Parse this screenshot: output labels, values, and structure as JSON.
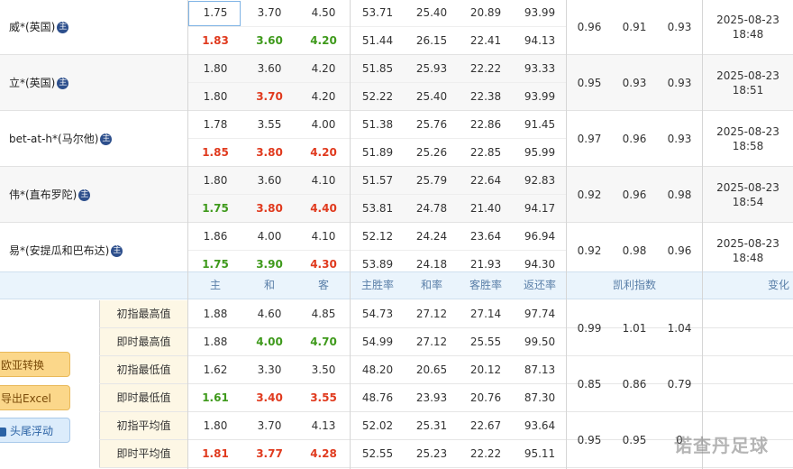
{
  "bookmakers": [
    {
      "name": "威*(英国)",
      "initial": [
        "1.75",
        "3.70",
        "4.50"
      ],
      "current": [
        "1.83",
        "3.60",
        "4.20"
      ],
      "current_colors": [
        "red",
        "green",
        "green"
      ],
      "initial_rates": [
        "53.71",
        "25.40",
        "20.89",
        "93.99"
      ],
      "current_rates": [
        "51.44",
        "26.15",
        "22.41",
        "94.13"
      ],
      "kelly": [
        "0.96",
        "0.91",
        "0.93"
      ],
      "date": "2025-08-23",
      "time": "18:48"
    },
    {
      "name": "立*(英国)",
      "initial": [
        "1.80",
        "3.60",
        "4.20"
      ],
      "current": [
        "1.80",
        "3.70",
        "4.20"
      ],
      "current_colors": [
        "",
        "red",
        ""
      ],
      "initial_rates": [
        "51.85",
        "25.93",
        "22.22",
        "93.33"
      ],
      "current_rates": [
        "52.22",
        "25.40",
        "22.38",
        "93.99"
      ],
      "kelly": [
        "0.95",
        "0.93",
        "0.93"
      ],
      "date": "2025-08-23",
      "time": "18:51"
    },
    {
      "name": "bet-at-h*(马尔他)",
      "initial": [
        "1.78",
        "3.55",
        "4.00"
      ],
      "current": [
        "1.85",
        "3.80",
        "4.20"
      ],
      "current_colors": [
        "red",
        "red",
        "red"
      ],
      "initial_rates": [
        "51.38",
        "25.76",
        "22.86",
        "91.45"
      ],
      "current_rates": [
        "51.89",
        "25.26",
        "22.85",
        "95.99"
      ],
      "kelly": [
        "0.97",
        "0.96",
        "0.93"
      ],
      "date": "2025-08-23",
      "time": "18:58"
    },
    {
      "name": "伟*(直布罗陀)",
      "initial": [
        "1.80",
        "3.60",
        "4.10"
      ],
      "current": [
        "1.75",
        "3.80",
        "4.40"
      ],
      "current_colors": [
        "green",
        "red",
        "red"
      ],
      "initial_rates": [
        "51.57",
        "25.79",
        "22.64",
        "92.83"
      ],
      "current_rates": [
        "53.81",
        "24.78",
        "21.40",
        "94.17"
      ],
      "kelly": [
        "0.92",
        "0.96",
        "0.98"
      ],
      "date": "2025-08-23",
      "time": "18:54"
    },
    {
      "name": "易*(安提瓜和巴布达)",
      "initial": [
        "1.86",
        "4.00",
        "4.10"
      ],
      "current": [
        "1.75",
        "3.90",
        "4.30"
      ],
      "current_colors": [
        "green",
        "green",
        "red"
      ],
      "initial_rates": [
        "52.12",
        "24.24",
        "23.64",
        "96.94"
      ],
      "current_rates": [
        "53.89",
        "24.18",
        "21.93",
        "94.30"
      ],
      "kelly": [
        "0.92",
        "0.98",
        "0.96"
      ],
      "date": "2025-08-23",
      "time": "18:48"
    }
  ],
  "header": {
    "home": "主",
    "draw": "和",
    "away": "客",
    "home_rate": "主胜率",
    "draw_rate": "和率",
    "away_rate": "客胜率",
    "return_rate": "返还率",
    "kelly": "凯利指数",
    "change": "变化"
  },
  "stats": [
    {
      "label": "初指最高值",
      "values": [
        "1.88",
        "4.60",
        "4.85"
      ],
      "colors": [
        "",
        "",
        ""
      ],
      "rates": [
        "54.73",
        "27.12",
        "27.14",
        "97.74"
      ]
    },
    {
      "label": "即时最高值",
      "values": [
        "1.88",
        "4.00",
        "4.70"
      ],
      "colors": [
        "",
        "green",
        "green"
      ],
      "rates": [
        "54.99",
        "27.12",
        "25.55",
        "99.50"
      ]
    },
    {
      "label": "初指最低值",
      "values": [
        "1.62",
        "3.30",
        "3.50"
      ],
      "colors": [
        "",
        "",
        ""
      ],
      "rates": [
        "48.20",
        "20.65",
        "20.12",
        "87.13"
      ]
    },
    {
      "label": "即时最低值",
      "values": [
        "1.61",
        "3.40",
        "3.55"
      ],
      "colors": [
        "green",
        "red",
        "red"
      ],
      "rates": [
        "48.76",
        "23.93",
        "20.76",
        "87.30"
      ]
    },
    {
      "label": "初指平均值",
      "values": [
        "1.80",
        "3.70",
        "4.13"
      ],
      "colors": [
        "",
        "",
        ""
      ],
      "rates": [
        "52.02",
        "25.31",
        "22.67",
        "93.64"
      ]
    },
    {
      "label": "即时平均值",
      "values": [
        "1.81",
        "3.77",
        "4.28"
      ],
      "colors": [
        "red",
        "red",
        "red"
      ],
      "rates": [
        "52.55",
        "25.23",
        "22.22",
        "95.11"
      ]
    }
  ],
  "stats_kelly": [
    [
      "0.99",
      "1.01",
      "1.04"
    ],
    [
      "0.85",
      "0.86",
      "0.79"
    ],
    [
      "0.95",
      "0.95",
      "0"
    ]
  ],
  "buttons": {
    "euro_asia": "欧亚转换",
    "export": "导出Excel",
    "float": "头尾浮动"
  },
  "icons": {
    "zhu_icon": "主"
  },
  "watermark": "诺查丹足球",
  "colors": {
    "red": "#e03a1e",
    "green": "#3f9a1c",
    "header_bg": "#eaf4fc",
    "label_bg": "#fdf7e5",
    "button_orange": "#fbd78a",
    "button_blue": "#dcecfb"
  }
}
